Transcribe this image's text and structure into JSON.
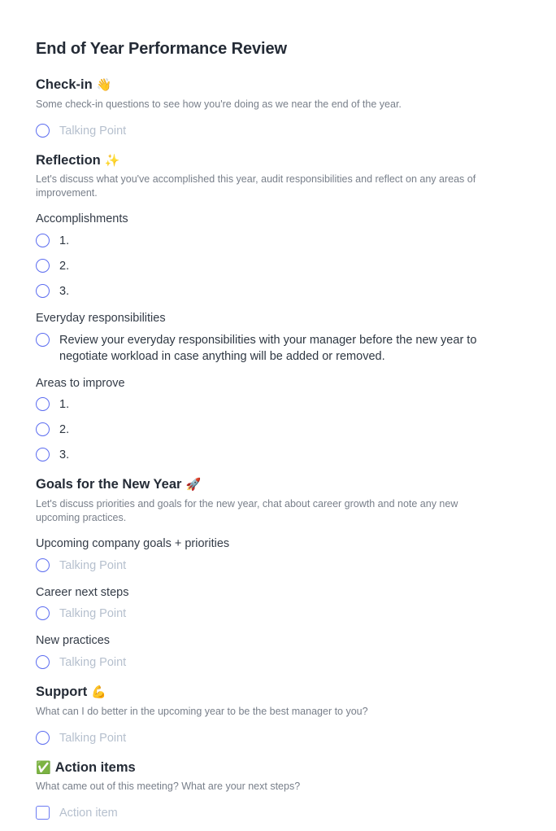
{
  "document": {
    "title": "End of Year Performance Review"
  },
  "colors": {
    "accent_radio": "#5b6cf0",
    "accent_checkbox": "#6b7bf3",
    "heading": "#242b36",
    "description": "#787f8a",
    "placeholder": "#b6c0ce",
    "body_text": "#2e3742"
  },
  "sections": [
    {
      "id": "check-in",
      "heading": "Check-in",
      "emoji": "👋",
      "emoji_position": "after",
      "description": "Some check-in questions to see how you're doing as we near the end of the year.",
      "groups": [
        {
          "sub_heading": null,
          "items": [
            {
              "type": "radio",
              "text": "Talking Point",
              "placeholder": true
            }
          ]
        }
      ]
    },
    {
      "id": "reflection",
      "heading": "Reflection",
      "emoji": "✨",
      "emoji_position": "after",
      "description": "Let's discuss what you've accomplished this year, audit responsibilities and reflect on any areas of improvement.",
      "groups": [
        {
          "sub_heading": "Accomplishments",
          "items": [
            {
              "type": "radio",
              "text": "1.",
              "placeholder": false
            },
            {
              "type": "radio",
              "text": "2.",
              "placeholder": false
            },
            {
              "type": "radio",
              "text": "3.",
              "placeholder": false
            }
          ]
        },
        {
          "sub_heading": "Everyday responsibilities",
          "items": [
            {
              "type": "radio",
              "text": "Review your everyday responsibilities with your manager before the new year to negotiate workload in case anything will be added or removed.",
              "placeholder": false
            }
          ]
        },
        {
          "sub_heading": "Areas to improve",
          "items": [
            {
              "type": "radio",
              "text": "1.",
              "placeholder": false
            },
            {
              "type": "radio",
              "text": "2.",
              "placeholder": false
            },
            {
              "type": "radio",
              "text": "3.",
              "placeholder": false
            }
          ]
        }
      ]
    },
    {
      "id": "goals",
      "heading": "Goals for the New Year",
      "emoji": "🚀",
      "emoji_position": "after",
      "description": "Let's discuss priorities and goals for the new year, chat about career growth and note any new upcoming practices.",
      "groups": [
        {
          "sub_heading": "Upcoming company goals + priorities",
          "items": [
            {
              "type": "radio",
              "text": "Talking Point",
              "placeholder": true
            }
          ]
        },
        {
          "sub_heading": "Career next steps",
          "items": [
            {
              "type": "radio",
              "text": "Talking Point",
              "placeholder": true
            }
          ]
        },
        {
          "sub_heading": "New practices",
          "items": [
            {
              "type": "radio",
              "text": "Talking Point",
              "placeholder": true
            }
          ]
        }
      ]
    },
    {
      "id": "support",
      "heading": "Support",
      "emoji": "💪",
      "emoji_position": "after",
      "description": "What can I do better in the upcoming year to be the best manager to you?",
      "groups": [
        {
          "sub_heading": null,
          "items": [
            {
              "type": "radio",
              "text": "Talking Point",
              "placeholder": true
            }
          ]
        }
      ]
    },
    {
      "id": "action-items",
      "heading": "Action items",
      "emoji": "✅",
      "emoji_position": "before",
      "description": "What came out of this meeting? What are your next steps?",
      "groups": [
        {
          "sub_heading": null,
          "items": [
            {
              "type": "checkbox",
              "text": "Action item",
              "placeholder": true
            }
          ]
        }
      ]
    }
  ]
}
